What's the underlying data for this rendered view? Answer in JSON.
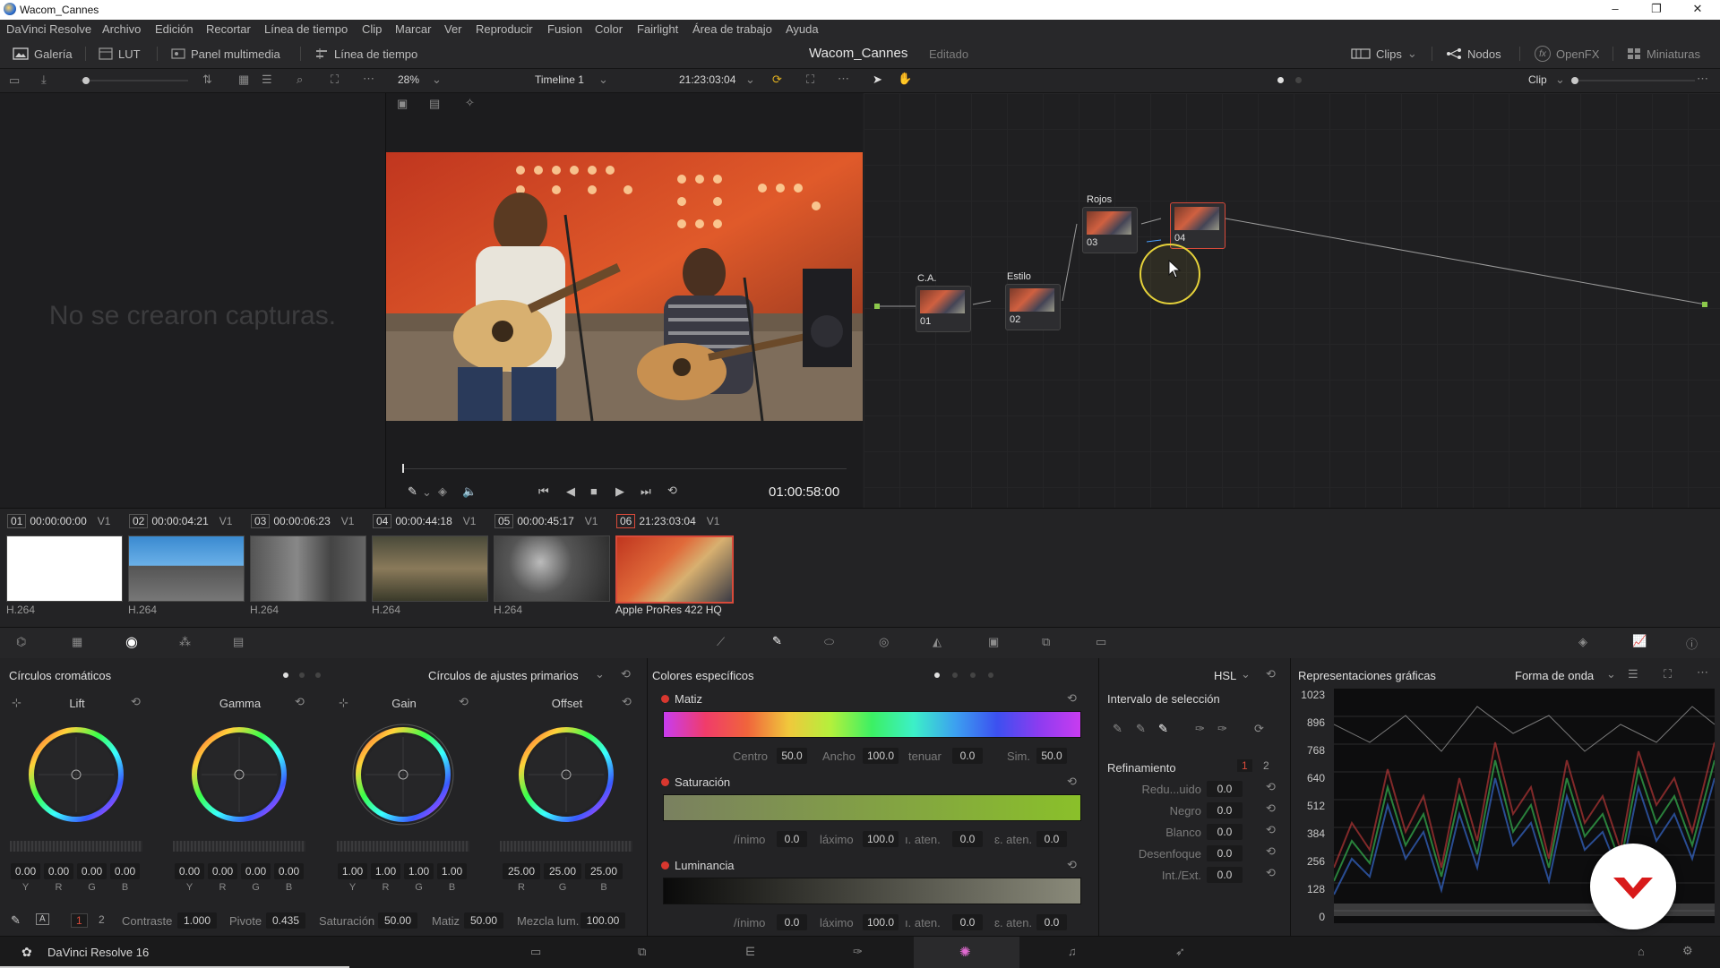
{
  "window": {
    "title": "Wacom_Cannes",
    "controls": [
      "–",
      "❐",
      "✕"
    ]
  },
  "menu": [
    "DaVinci Resolve",
    "Archivo",
    "Edición",
    "Recortar",
    "Línea de tiempo",
    "Clip",
    "Marcar",
    "Ver",
    "Reproducir",
    "Fusion",
    "Color",
    "Fairlight",
    "Área de trabajo",
    "Ayuda"
  ],
  "toolbar": {
    "gallery": "Galería",
    "lut": "LUT",
    "media_pool": "Panel multimedia",
    "timeline": "Línea de tiempo",
    "project_title": "Wacom_Cannes",
    "project_status": "Editado",
    "clips": "Clips",
    "nodes": "Nodos",
    "openfx": "OpenFX",
    "thumbnails": "Miniaturas"
  },
  "viewer_bar": {
    "zoom": "28%",
    "timeline_name": "Timeline 1",
    "timecode": "21:23:03:04",
    "node_mode": "Clip"
  },
  "gallery": {
    "empty_message": "No se crearon capturas."
  },
  "viewer": {
    "playback_timecode": "01:00:58:00"
  },
  "nodes": [
    {
      "label": "C.A.",
      "num": "01"
    },
    {
      "label": "Estilo",
      "num": "02"
    },
    {
      "label": "Rojos",
      "num": "03"
    },
    {
      "label": "",
      "num": "04"
    }
  ],
  "clips": [
    {
      "num": "01",
      "tc": "00:00:00:00",
      "track": "V1",
      "codec": "H.264"
    },
    {
      "num": "02",
      "tc": "00:00:04:21",
      "track": "V1",
      "codec": "H.264"
    },
    {
      "num": "03",
      "tc": "00:00:06:23",
      "track": "V1",
      "codec": "H.264"
    },
    {
      "num": "04",
      "tc": "00:00:44:18",
      "track": "V1",
      "codec": "H.264"
    },
    {
      "num": "05",
      "tc": "00:00:45:17",
      "track": "V1",
      "codec": "H.264"
    },
    {
      "num": "06",
      "tc": "21:23:03:04",
      "track": "V1",
      "codec": "Apple ProRes 422 HQ"
    }
  ],
  "wheels": {
    "title": "Círculos cromáticos",
    "mode": "Círculos de ajustes primarios",
    "items": [
      {
        "name": "Lift",
        "values": [
          "0.00",
          "0.00",
          "0.00",
          "0.00"
        ],
        "keys": [
          "Y",
          "R",
          "G",
          "B"
        ]
      },
      {
        "name": "Gamma",
        "values": [
          "0.00",
          "0.00",
          "0.00",
          "0.00"
        ],
        "keys": [
          "Y",
          "R",
          "G",
          "B"
        ]
      },
      {
        "name": "Gain",
        "values": [
          "1.00",
          "1.00",
          "1.00",
          "1.00"
        ],
        "keys": [
          "Y",
          "R",
          "G",
          "B"
        ]
      },
      {
        "name": "Offset",
        "values": [
          "25.00",
          "25.00",
          "25.00"
        ],
        "keys": [
          "R",
          "G",
          "B"
        ]
      }
    ],
    "bottom": {
      "page1": "1",
      "page2": "2",
      "contrast_label": "Contraste",
      "contrast": "1.000",
      "pivot_label": "Pivote",
      "pivot": "0.435",
      "sat_label": "Saturación",
      "sat": "50.00",
      "hue_label": "Matiz",
      "hue": "50.00",
      "lummix_label": "Mezcla lum.",
      "lummix": "100.00"
    }
  },
  "qualifier": {
    "title": "Colores específicos",
    "mode": "HSL",
    "hue": {
      "title": "Matiz",
      "centro_label": "Centro",
      "centro": "50.0",
      "ancho_label": "Ancho",
      "ancho": "100.0",
      "tenuar_label": "tenuar",
      "tenuar": "0.0",
      "sim_label": "Sim.",
      "sim": "50.0"
    },
    "sat": {
      "title": "Saturación",
      "min_label": "/ínimo",
      "min": "0.0",
      "max_label": "láximo",
      "max": "100.0",
      "baten_label": "ı. aten.",
      "baten": "0.0",
      "aaten_label": "ɛ. aten.",
      "aaten": "0.0"
    },
    "lum": {
      "title": "Luminancia",
      "min_label": "/ínimo",
      "min": "0.0",
      "max_label": "láximo",
      "max": "100.0",
      "baten_label": "ı. aten.",
      "baten": "0.0",
      "aaten_label": "ɛ. aten.",
      "aaten": "0.0"
    },
    "selection_title": "Intervalo de selección",
    "refine_title": "Refinamiento",
    "refine_page1": "1",
    "refine_page2": "2",
    "refine": [
      {
        "label": "Redu...uido",
        "value": "0.0"
      },
      {
        "label": "Negro",
        "value": "0.0"
      },
      {
        "label": "Blanco",
        "value": "0.0"
      },
      {
        "label": "Desenfoque",
        "value": "0.0"
      },
      {
        "label": "Int./Ext.",
        "value": "0.0"
      }
    ]
  },
  "scopes": {
    "title": "Representaciones gráficas",
    "mode": "Forma de onda",
    "ticks": [
      "1023",
      "896",
      "768",
      "640",
      "512",
      "384",
      "256",
      "128",
      "0"
    ]
  },
  "footer": {
    "app": "DaVinci Resolve 16"
  }
}
